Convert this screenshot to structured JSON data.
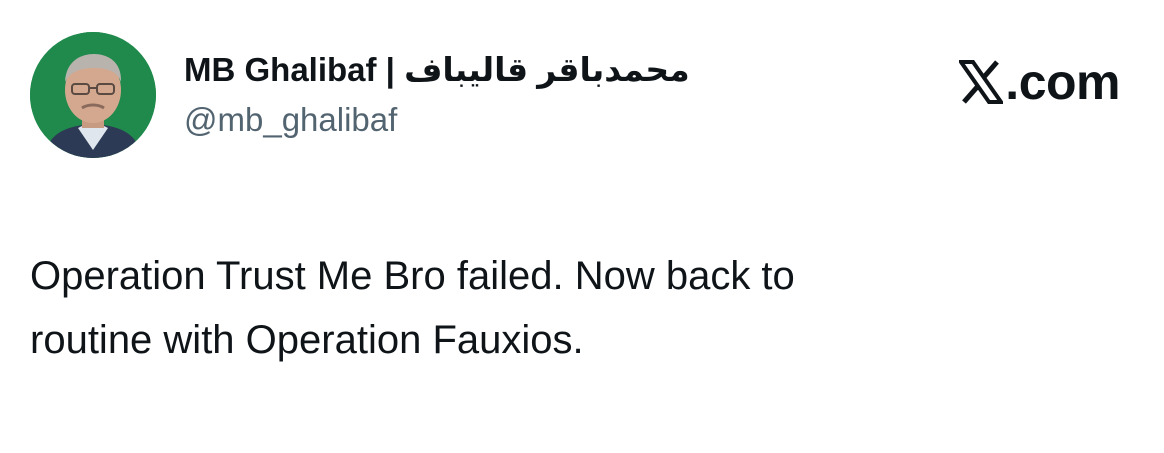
{
  "tweet": {
    "author": {
      "display_name": "MB Ghalibaf | محمدباقر قالیباف",
      "handle": "@mb_ghalibaf",
      "avatar_icon": "profile-photo"
    },
    "source_logo": {
      "icon": "x-logo-icon",
      "domain_suffix": ".com"
    },
    "text_line_1": "Operation Trust Me Bro failed. Now back to",
    "text_line_2": "routine with Operation Fauxios."
  },
  "colors": {
    "text_primary": "#0f1419",
    "text_secondary": "#536471",
    "avatar_background": "#1f8a4c",
    "background": "#ffffff"
  }
}
